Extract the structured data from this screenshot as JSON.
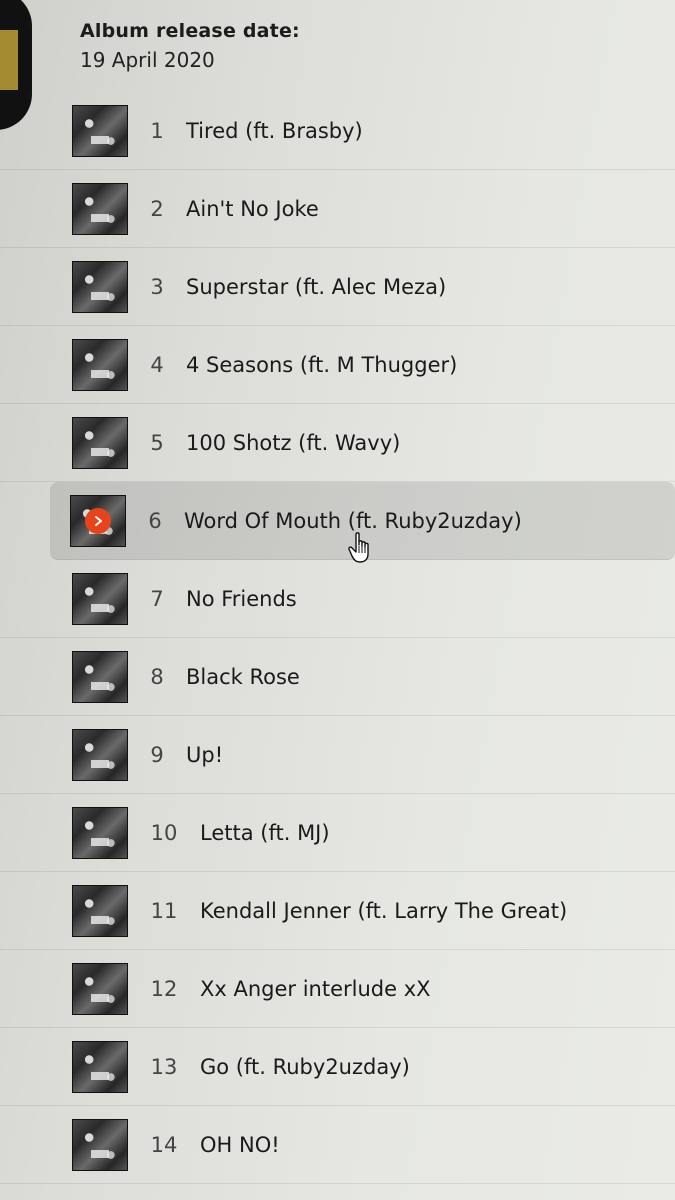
{
  "release": {
    "label": "Album release date:",
    "date": "19 April 2020"
  },
  "tracks": [
    {
      "number": "1",
      "title": "Tired (ft. Brasby)"
    },
    {
      "number": "2",
      "title": "Ain't No Joke"
    },
    {
      "number": "3",
      "title": "Superstar (ft. Alec Meza)"
    },
    {
      "number": "4",
      "title": "4 Seasons (ft. M Thugger)"
    },
    {
      "number": "5",
      "title": "100 Shotz (ft. Wavy)"
    },
    {
      "number": "6",
      "title": "Word Of Mouth (ft. Ruby2uzday)"
    },
    {
      "number": "7",
      "title": "No Friends"
    },
    {
      "number": "8",
      "title": "Black Rose"
    },
    {
      "number": "9",
      "title": "Up!"
    },
    {
      "number": "10",
      "title": "Letta (ft. MJ)"
    },
    {
      "number": "11",
      "title": "Kendall Jenner (ft. Larry The Great)"
    },
    {
      "number": "12",
      "title": "Xx Anger interlude xX"
    },
    {
      "number": "13",
      "title": "Go (ft. Ruby2uzday)"
    },
    {
      "number": "14",
      "title": "OH NO!"
    }
  ],
  "active_track": "6",
  "colors": {
    "play_button": "#e8441b",
    "hover_row": "#d3d4d0"
  },
  "icons": {
    "play": "play-icon",
    "cursor": "hand-pointer-icon"
  }
}
